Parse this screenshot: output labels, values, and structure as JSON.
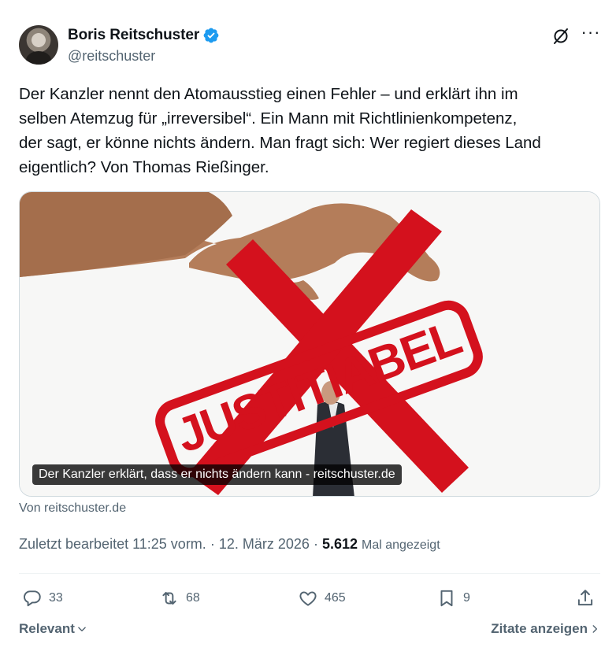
{
  "author": {
    "name": "Boris Reitschuster",
    "handle": "@reitschuster",
    "verified": true,
    "verified_color": "#1d9bf0"
  },
  "tweet": {
    "text": "Der Kanzler nennt den Atomausstieg einen Fehler – und erklärt ihn im\nselben Atemzug für „irreversibel“. Ein Mann mit Richtlinienkompetenz,\nder sagt, er könne nichts ändern. Man fragt sich: Wer regiert dieses Land\neigentlich? Von Thomas Rießinger."
  },
  "card": {
    "caption": "Der Kanzler erklärt, dass er nichts ändern kann - reitschuster.de",
    "stamp_text": "JUSTITIABEL",
    "stamp_color": "#d4111d",
    "source": "Von reitschuster.de"
  },
  "meta": {
    "edited_label": "Zuletzt bearbeitet",
    "time": "11:25 vorm.",
    "date": "12. März 2026",
    "views": "5.612",
    "views_label": "Mal angezeigt"
  },
  "actions": {
    "replies": "33",
    "reposts": "68",
    "likes": "465",
    "bookmarks": "9"
  },
  "footer": {
    "sort_label": "Relevant",
    "quotes_label": "Zitate anzeigen"
  },
  "colors": {
    "text": "#0f1419",
    "secondary": "#536471",
    "border": "#cfd9de"
  }
}
